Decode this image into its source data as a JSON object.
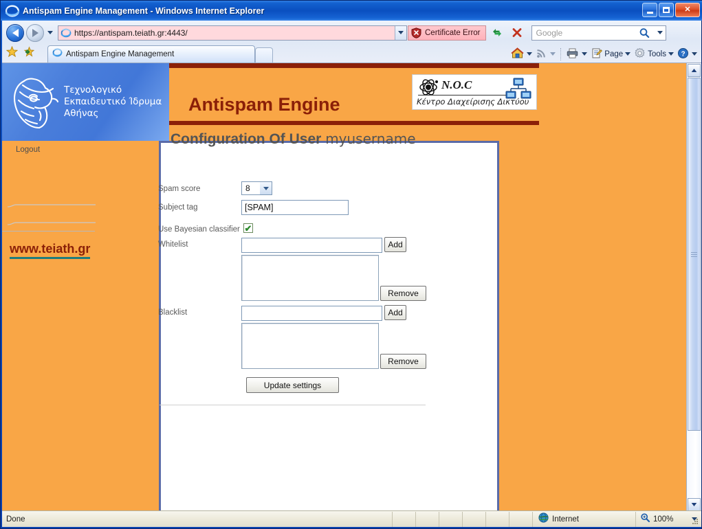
{
  "window": {
    "title": "Antispam Engine Management - Windows Internet Explorer",
    "minimize_label": "Minimize",
    "maximize_label": "Maximize",
    "close_label": "Close"
  },
  "toolbar": {
    "back_label": "Back",
    "forward_label": "Forward",
    "recent_pages_label": "Recent Pages",
    "address_url": "https://antispam.teiath.gr:4443/",
    "address_dropdown_label": "Address dropdown",
    "certificate_error_label": "Certificate Error",
    "refresh_label": "Refresh",
    "stop_label": "Stop",
    "search_placeholder": "Google",
    "search_go_label": "Search",
    "search_dropdown_label": "Search provider dropdown"
  },
  "favorites": {
    "favorites_center_label": "Favorites Center",
    "add_to_favorites_label": "Add to Favorites"
  },
  "tabs": [
    {
      "label": "Antispam Engine Management",
      "active": true
    }
  ],
  "new_tab_label": "New Tab",
  "command_bar": [
    {
      "name": "home",
      "label": "Home",
      "has_menu": true
    },
    {
      "name": "feeds",
      "label": "Feeds",
      "has_menu": true
    },
    {
      "name": "print",
      "label": "Print",
      "has_menu": true
    },
    {
      "name": "page",
      "label": "Page",
      "has_menu": true
    },
    {
      "name": "tools",
      "label": "Tools",
      "has_menu": true
    },
    {
      "name": "help",
      "label": "Help",
      "has_menu": true
    }
  ],
  "page": {
    "institute_name_lines": [
      "Τεχνολογικό",
      "Εκπαιδευτικό  Ίδρυμα",
      "Αθήνας"
    ],
    "banner_title": "Antispam Engine",
    "noc": {
      "name": "N.O.C",
      "subtitle": "Κέντρο Διαχείρισης Δικτύου"
    },
    "nav": {
      "logout": "Logout",
      "site_link": "www.teiath.gr"
    },
    "heading_bold": "Configuration Of User",
    "heading_user": "myusername",
    "form": {
      "spam_score_label": "Spam score",
      "spam_score_value": "8",
      "subject_tag_label": "Subject tag",
      "subject_tag_value": "[SPAM]",
      "bayesian_label": "Use Bayesian classifier",
      "bayesian_checked": true,
      "whitelist_label": "Whitelist",
      "whitelist_input_value": "",
      "whitelist_items": [],
      "whitelist_add_label": "Add",
      "whitelist_remove_label": "Remove",
      "blacklist_label": "Blacklist",
      "blacklist_input_value": "",
      "blacklist_items": [],
      "blacklist_add_label": "Add",
      "blacklist_remove_label": "Remove",
      "submit_label": "Update settings"
    }
  },
  "scrollbar": {
    "up_label": "Scroll up",
    "down_label": "Scroll down",
    "thumb_label": "Scroll thumb"
  },
  "status_bar": {
    "status_text": "Done",
    "zone_label": "Internet",
    "zoom_level": "100%",
    "zoom_dropdown_label": "Change zoom level"
  },
  "colors": {
    "page_background": "#f9a646",
    "banner_accent": "#8b2008",
    "logo_panel": "#4a7edb",
    "content_border": "#5a6ba8",
    "link_underline": "#1f7d7d",
    "title_bar": "#0a4fc0"
  }
}
